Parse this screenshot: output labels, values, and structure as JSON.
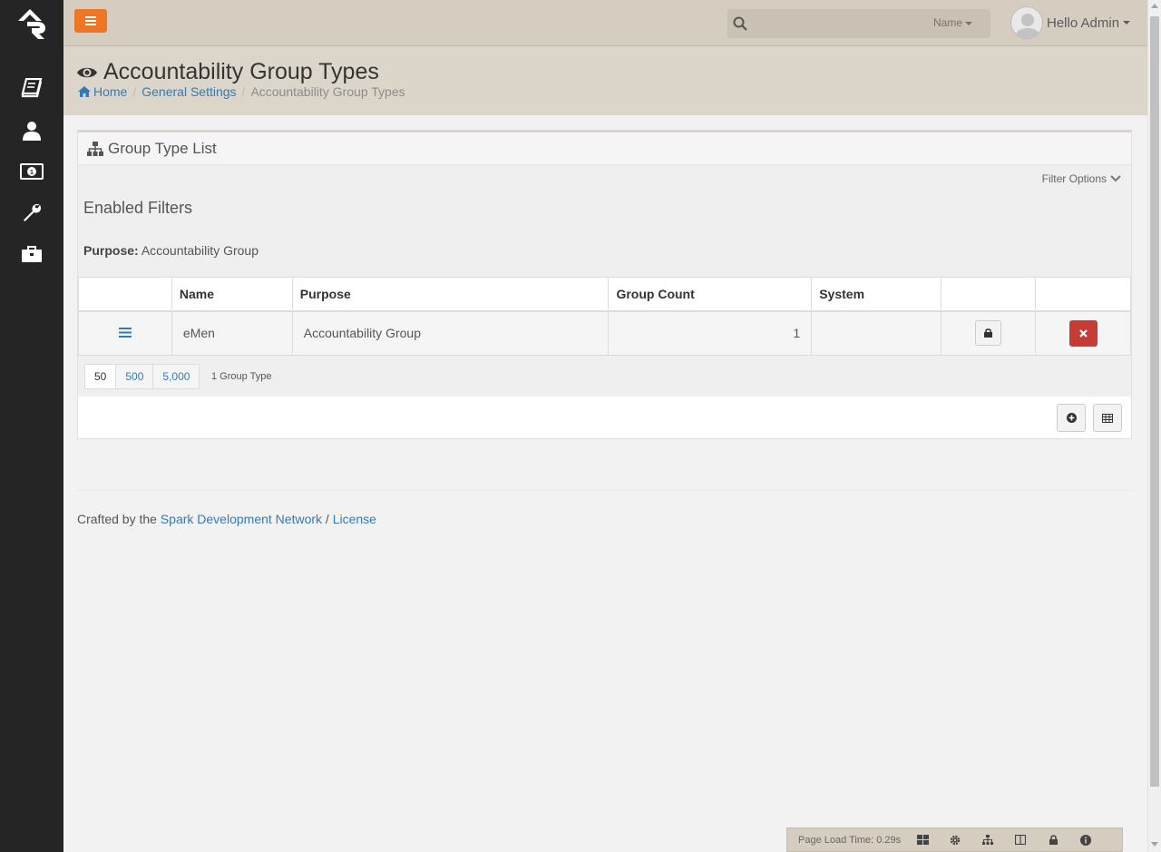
{
  "header": {
    "search_placeholder": "",
    "search_type": "Name",
    "user_greeting": "Hello Admin"
  },
  "page": {
    "title": "Accountability Group Types",
    "breadcrumb": [
      "Home",
      "General Settings",
      "Accountability Group Types"
    ]
  },
  "panel": {
    "title": "Group Type List",
    "filter_options_label": "Filter Options",
    "enabled_filters_label": "Enabled Filters",
    "filter_name": "Purpose:",
    "filter_value": "Accountability Group"
  },
  "grid": {
    "columns": [
      "",
      "Name",
      "Purpose",
      "Group Count",
      "System",
      "",
      ""
    ],
    "rows": [
      {
        "name": "eMen",
        "purpose": "Accountability Group",
        "group_count": "1",
        "system": ""
      }
    ],
    "page_sizes": [
      "50",
      "500",
      "5,000"
    ],
    "item_count": "1 Group Type"
  },
  "footer": {
    "prefix": "Crafted by the",
    "link1": "Spark Development Network",
    "sep": "/",
    "link2": "License"
  },
  "admin_bar": {
    "load_time": "Page Load Time: 0.29s"
  },
  "colors": {
    "accent": "#ee7624",
    "header_bg": "#d5cdbf",
    "sidebar_bg": "#252525",
    "link": "#337ab7",
    "danger": "#c73b36"
  }
}
